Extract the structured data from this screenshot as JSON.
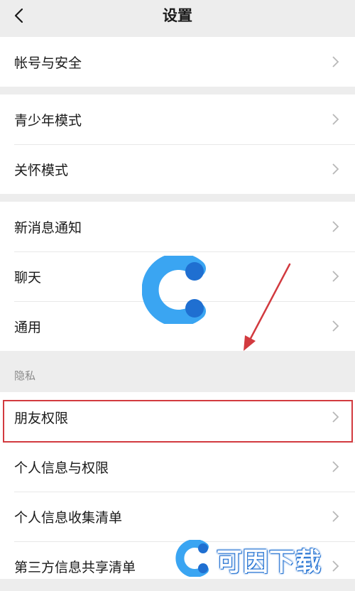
{
  "header": {
    "title": "设置",
    "back_icon": "chevron-left-icon"
  },
  "groups": [
    {
      "items": [
        {
          "label": "帐号与安全"
        }
      ]
    },
    {
      "items": [
        {
          "label": "青少年模式"
        },
        {
          "label": "关怀模式"
        }
      ]
    },
    {
      "items": [
        {
          "label": "新消息通知"
        },
        {
          "label": "聊天"
        },
        {
          "label": "通用"
        }
      ]
    },
    {
      "section": "隐私",
      "items": [
        {
          "label": "朋友权限"
        },
        {
          "label": "个人信息与权限"
        },
        {
          "label": "个人信息收集清单"
        },
        {
          "label": "第三方信息共享清单"
        }
      ]
    }
  ],
  "annotation": {
    "highlight_color": "#d23a3f",
    "arrow_color": "#d23a3f"
  },
  "watermark": {
    "text": "可因下载",
    "logo_colors": [
      "#3aa5f2",
      "#1f6fd1"
    ]
  }
}
